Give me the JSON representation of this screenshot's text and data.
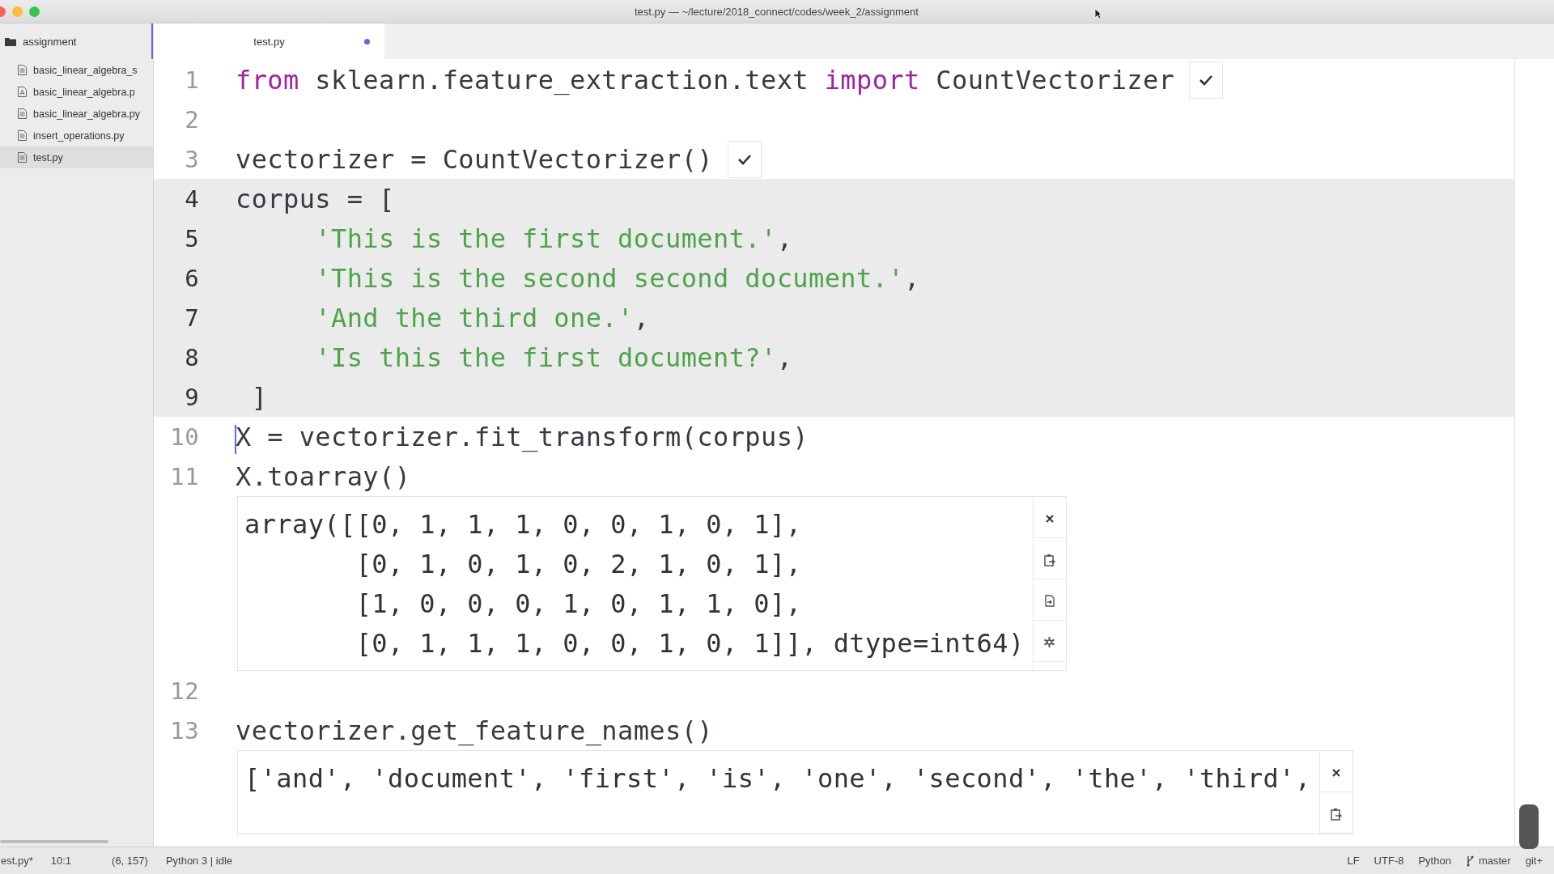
{
  "window": {
    "title": "test.py — ~/lecture/2018_connect/codes/week_2/assignment"
  },
  "sidebar": {
    "folder": "assignment",
    "items": [
      {
        "name": "basic_linear_algebra_s",
        "kind": "text",
        "selected": false
      },
      {
        "name": "basic_linear_algebra.p",
        "kind": "pdf",
        "selected": false
      },
      {
        "name": "basic_linear_algebra.py",
        "kind": "text",
        "selected": false
      },
      {
        "name": "insert_operations.py",
        "kind": "text",
        "selected": false
      },
      {
        "name": "test.py",
        "kind": "text",
        "selected": true
      }
    ]
  },
  "tabs": [
    {
      "label": "test.py",
      "selected": true,
      "modified": true
    }
  ],
  "editor": [
    {
      "kind": "line",
      "number": "1",
      "highlighted": false,
      "cursor": false,
      "checked": true,
      "tokens": [
        {
          "kind": "keyword",
          "text": "from"
        },
        {
          "kind": "plain",
          "text": " sklearn.feature_extraction.text "
        },
        {
          "kind": "keyword",
          "text": "import"
        },
        {
          "kind": "plain",
          "text": " CountVectorizer"
        }
      ]
    },
    {
      "kind": "line",
      "number": "2",
      "highlighted": false,
      "cursor": false,
      "checked": false
    },
    {
      "kind": "line",
      "number": "3",
      "highlighted": false,
      "cursor": false,
      "checked": true,
      "tokens": [
        {
          "kind": "plain",
          "text": "vectorizer = CountVectorizer()"
        }
      ]
    },
    {
      "kind": "line",
      "number": "4",
      "highlighted": true,
      "cursor": false,
      "checked": false,
      "tokens": [
        {
          "kind": "plain",
          "text": "corpus = ["
        }
      ]
    },
    {
      "kind": "line",
      "number": "5",
      "highlighted": true,
      "cursor": false,
      "checked": false,
      "tokens": [
        {
          "kind": "string",
          "text": "     'This is the first document.'"
        },
        {
          "kind": "plain",
          "text": ","
        }
      ]
    },
    {
      "kind": "line",
      "number": "6",
      "highlighted": true,
      "cursor": false,
      "checked": false,
      "tokens": [
        {
          "kind": "string",
          "text": "     'This is the second second document.'"
        },
        {
          "kind": "plain",
          "text": ","
        }
      ]
    },
    {
      "kind": "line",
      "number": "7",
      "highlighted": true,
      "cursor": false,
      "checked": false,
      "tokens": [
        {
          "kind": "string",
          "text": "     'And the third one.'"
        },
        {
          "kind": "plain",
          "text": ","
        }
      ]
    },
    {
      "kind": "line",
      "number": "8",
      "highlighted": true,
      "cursor": false,
      "checked": false,
      "tokens": [
        {
          "kind": "string",
          "text": "     'Is this the first document?'"
        },
        {
          "kind": "plain",
          "text": ","
        }
      ]
    },
    {
      "kind": "line",
      "number": "9",
      "highlighted": true,
      "cursor": false,
      "checked": false,
      "tokens": [
        {
          "kind": "plain",
          "text": " ]"
        }
      ]
    },
    {
      "kind": "line",
      "number": "10",
      "highlighted": false,
      "cursor": true,
      "checked": false,
      "tokens": [
        {
          "kind": "plain",
          "text": "X = vectorizer.fit_transform(corpus)"
        }
      ]
    },
    {
      "kind": "line",
      "number": "11",
      "highlighted": false,
      "cursor": false,
      "checked": false,
      "tokens": [
        {
          "kind": "plain",
          "text": "X.toarray()"
        }
      ]
    },
    {
      "kind": "output",
      "lines": [
        "array([[0, 1, 1, 1, 0, 0, 1, 0, 1],",
        "       [0, 1, 0, 1, 0, 2, 1, 0, 1],",
        "       [1, 0, 0, 0, 1, 0, 1, 1, 0],",
        "       [0, 1, 1, 1, 0, 0, 1, 0, 1]], dtype=int64)"
      ],
      "buttons": [
        {
          "kind": "close"
        },
        {
          "kind": "copy"
        },
        {
          "kind": "open"
        },
        {
          "kind": "settings"
        }
      ]
    },
    {
      "kind": "line",
      "number": "12",
      "highlighted": false,
      "cursor": false,
      "checked": false
    },
    {
      "kind": "line",
      "number": "13",
      "highlighted": false,
      "cursor": false,
      "checked": false,
      "tokens": [
        {
          "kind": "plain",
          "text": "vectorizer.get_feature_names()"
        }
      ]
    },
    {
      "kind": "output",
      "lines": [
        "['and', 'document', 'first', 'is', 'one', 'second', 'the', 'third',"
      ],
      "buttons": [
        {
          "kind": "close"
        },
        {
          "kind": "copy"
        }
      ]
    }
  ],
  "status_bar": {
    "left": [
      "est.py*",
      "10:1",
      "(6, 157)",
      "Python 3 | idle"
    ],
    "right": [
      {
        "text": "LF",
        "kind": "text"
      },
      {
        "text": "UTF-8",
        "kind": "text"
      },
      {
        "text": "Python",
        "kind": "text"
      },
      {
        "text": "master",
        "kind": "branch"
      },
      {
        "text": "git+",
        "kind": "text"
      }
    ]
  }
}
